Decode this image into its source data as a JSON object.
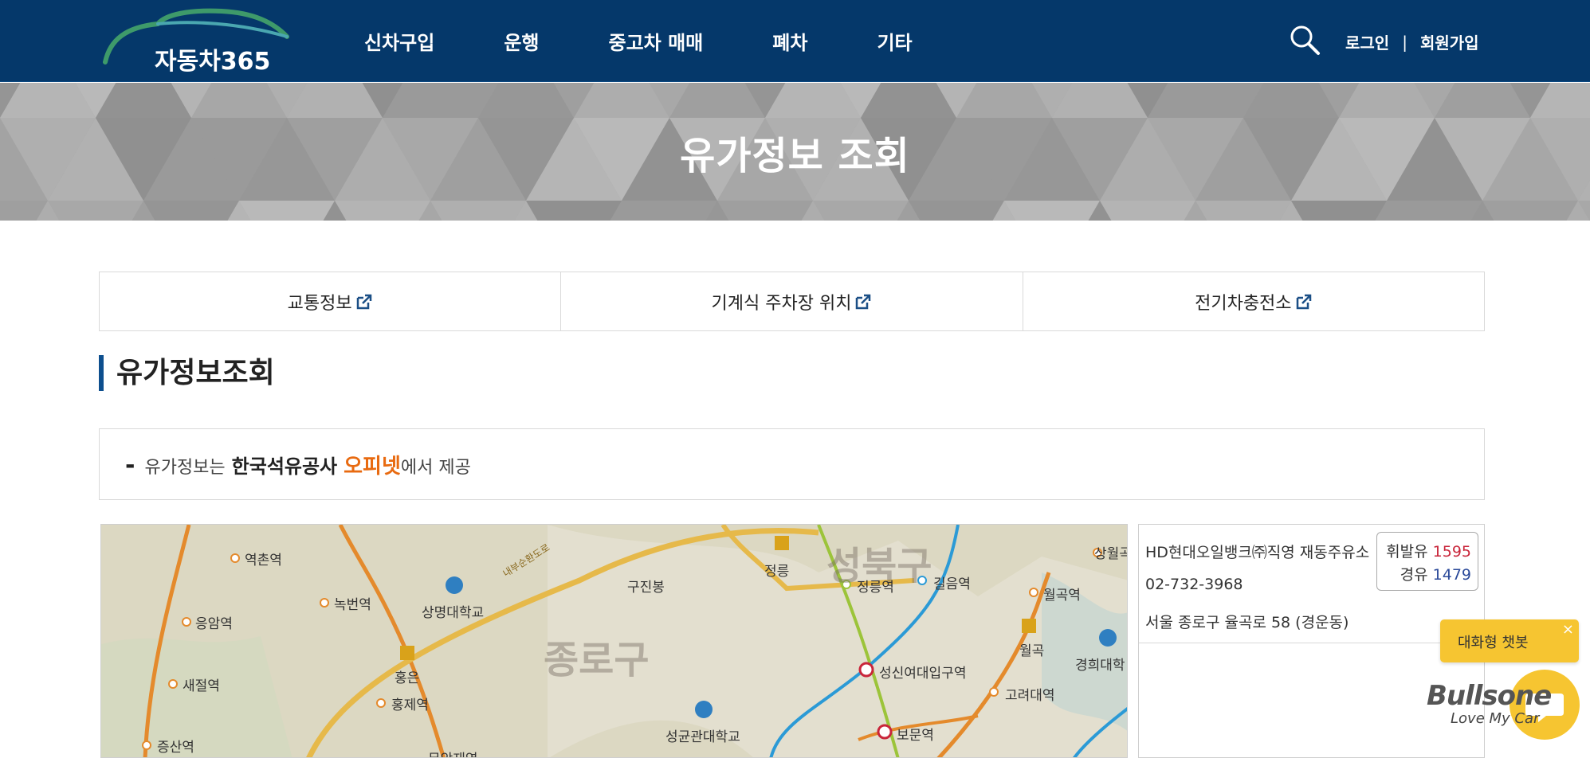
{
  "header": {
    "logo_text": "자동차365",
    "nav": [
      "신차구입",
      "운행",
      "중고차 매매",
      "폐차",
      "기타"
    ],
    "login": "로그인",
    "separator": "|",
    "signup": "회원가입",
    "bg_color": "#05386a"
  },
  "banner": {
    "title": "유가정보 조회"
  },
  "quick_links": [
    "교통정보",
    "기계식 주차장 위치",
    "전기차충전소"
  ],
  "section": {
    "title": "유가정보조회",
    "accent_color": "#0d4f8e"
  },
  "info": {
    "dash": "-",
    "prefix": "유가정보는",
    "agency": "한국석유공사",
    "service": "오피넷",
    "suffix": "에서 제공",
    "service_color": "#e86a10"
  },
  "map": {
    "districts": [
      "종로구",
      "성북구"
    ],
    "labels": [
      "역촌역",
      "녹번역",
      "상명대학교",
      "응암역",
      "새절역",
      "증산역",
      "홍은",
      "홍제역",
      "무악재역",
      "구진봉",
      "정릉",
      "정릉역",
      "길음역",
      "상월곡",
      "월곡역",
      "월곡",
      "경희대학",
      "성신여대입구역",
      "고려대역",
      "보문역",
      "성균관대학교",
      "내부순환도로"
    ]
  },
  "station": {
    "name": "HD현대오일뱅크㈜직영 재동주유소",
    "phone": "02-732-3968",
    "address": "서울 종로구 율곡로 58 (경운동)",
    "prices": [
      {
        "label": "휘발유",
        "value": "1595",
        "color": "#c9253a"
      },
      {
        "label": "경유",
        "value": "1479",
        "color": "#2b4a9a"
      }
    ]
  },
  "chatbot": {
    "label": "대화형 챗봇",
    "close": "×",
    "brand": "Bullsone",
    "tagline": "Love My Car"
  }
}
